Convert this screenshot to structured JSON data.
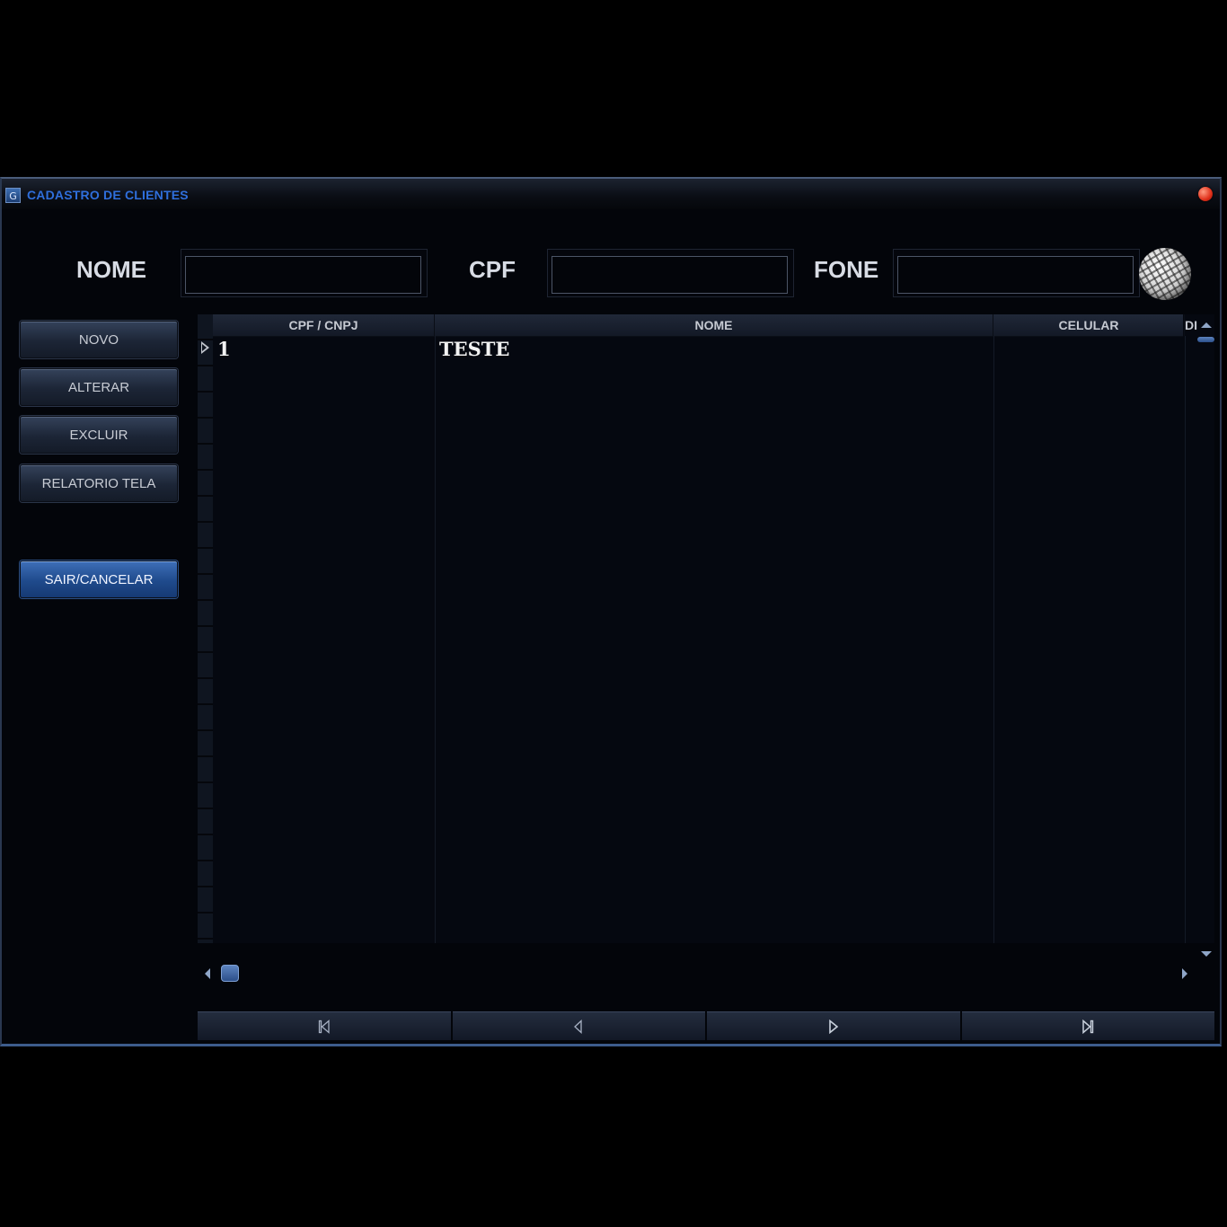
{
  "window": {
    "icon_letter": "G",
    "title": "CADASTRO DE CLIENTES"
  },
  "search": {
    "nome_label": "NOME",
    "nome_value": "",
    "cpf_label": "CPF",
    "cpf_value": "",
    "fone_label": "FONE",
    "fone_value": ""
  },
  "sidebar": {
    "novo": "NOVO",
    "alterar": "ALTERAR",
    "excluir": "EXCLUIR",
    "relatorio": "RELATORIO TELA",
    "sair": "SAIR/CANCELAR"
  },
  "grid": {
    "columns": [
      "CPF / CNPJ",
      "NOME",
      "CELULAR",
      "DI"
    ],
    "rows": [
      {
        "cpf_cnpj": "1",
        "nome": "TESTE",
        "celular": ""
      }
    ]
  },
  "navigator": {
    "buttons": [
      "first-icon",
      "prior-icon",
      "next-icon",
      "last-icon"
    ]
  },
  "colors": {
    "title_accent": "#2f6fdc",
    "primary_button": "#1f4a8c",
    "close_button": "#e0301a"
  }
}
